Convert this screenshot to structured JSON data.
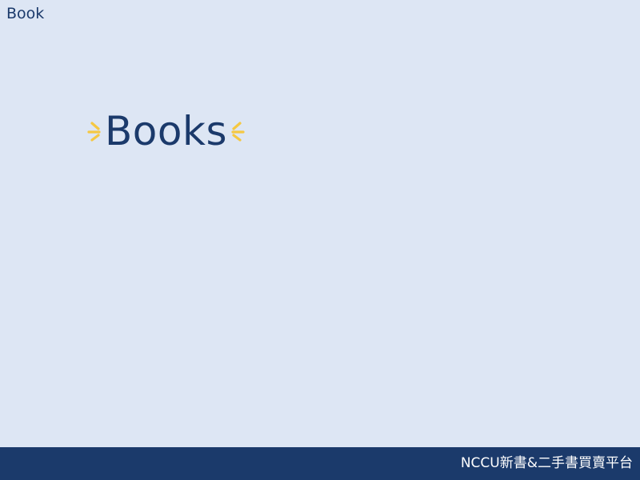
{
  "header": {
    "label": "Book"
  },
  "hero": {
    "title": "Books",
    "left_icon": "sparkle-icon",
    "right_icon": "sparkle-icon",
    "accent_color": "#f5c842"
  },
  "footer": {
    "text": "NCCU新書&二手書買賣平台"
  },
  "colors": {
    "background": "#dde6f4",
    "primary": "#1b3a6b",
    "footer_text": "#ffffff"
  }
}
